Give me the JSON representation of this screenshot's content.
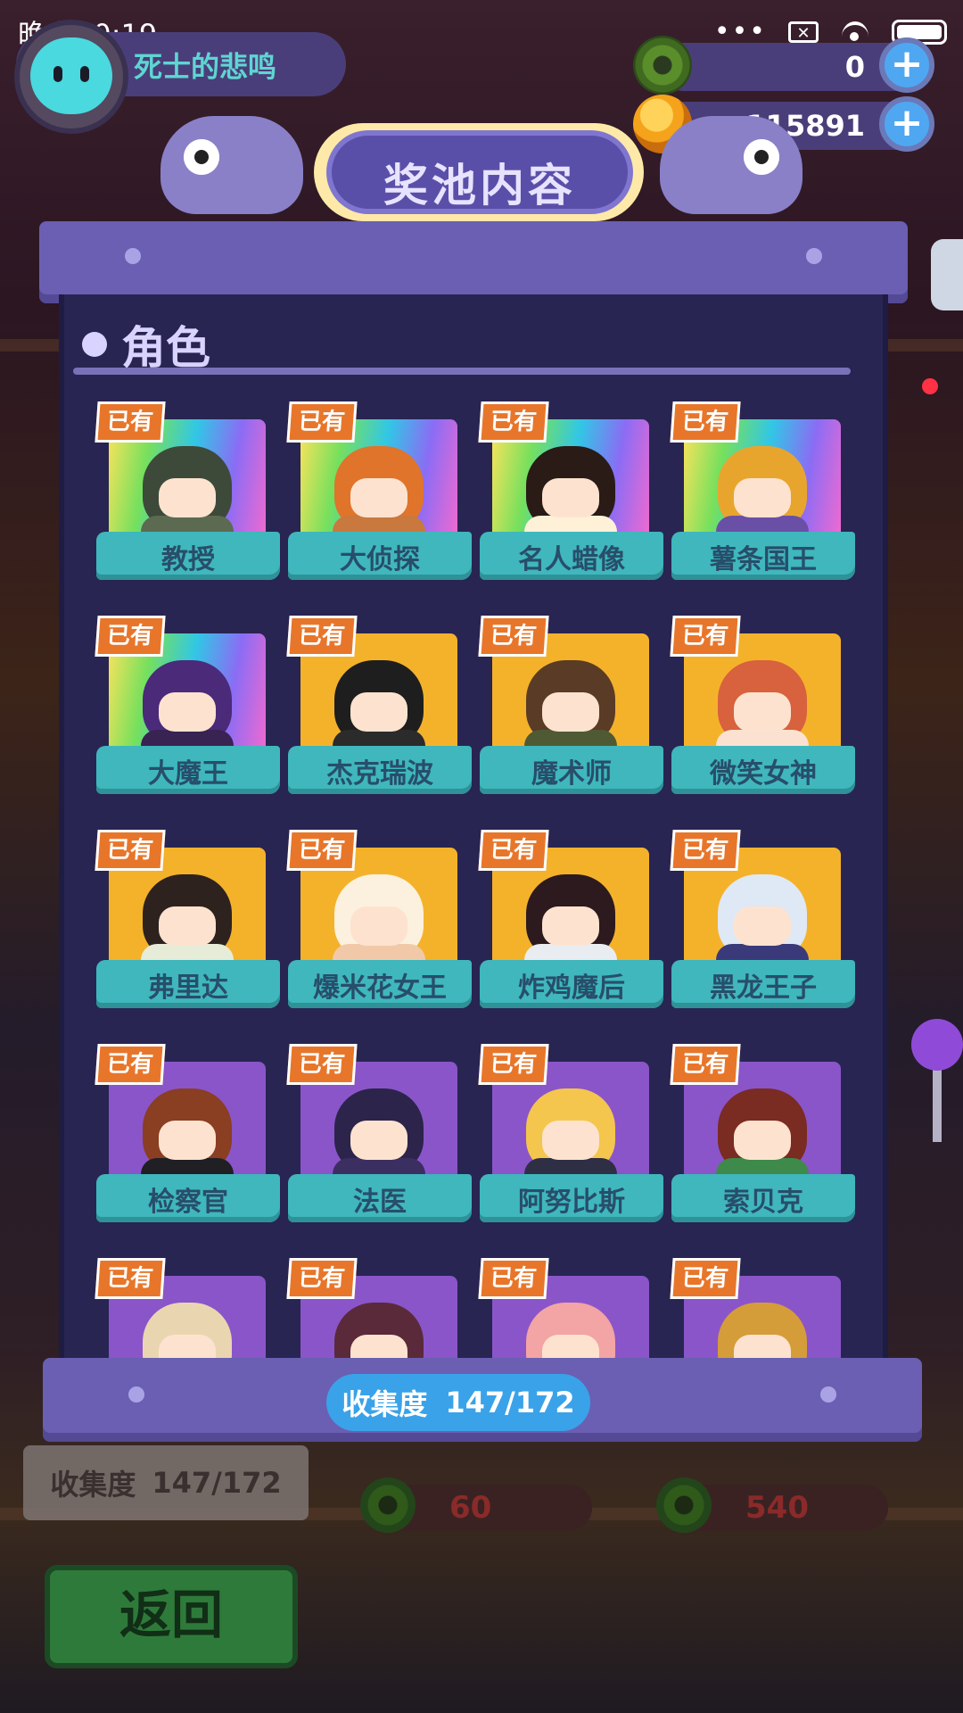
{
  "status_bar": {
    "time": "晚上10:19",
    "icons": [
      "more-dots-icon",
      "sim-x-icon",
      "wifi-icon",
      "battery-icon"
    ],
    "dots": "•••",
    "sim": "✕"
  },
  "player": {
    "name": "死士的悲鸣"
  },
  "currencies": {
    "donut": {
      "value": "0",
      "plus": "+"
    },
    "coin": {
      "value": "115891",
      "plus": "+"
    }
  },
  "title": "奖池内容",
  "section": {
    "label": "角色"
  },
  "owned_label": "已有",
  "characters": [
    {
      "name": "教授",
      "rarity": "rainbow",
      "hair": "#3d4a3a",
      "body": "#5c6a52"
    },
    {
      "name": "大侦探",
      "rarity": "rainbow",
      "hair": "#e0742a",
      "body": "#c9783e"
    },
    {
      "name": "名人蜡像",
      "rarity": "rainbow",
      "hair": "#2a1b17",
      "body": "#fff1d8"
    },
    {
      "name": "薯条国王",
      "rarity": "rainbow",
      "hair": "#e8a52e",
      "body": "#6a4fa6"
    },
    {
      "name": "大魔王",
      "rarity": "rainbow",
      "hair": "#4b2a7a",
      "body": "#382352"
    },
    {
      "name": "杰克瑞波",
      "rarity": "gold",
      "hair": "#1e1e1e",
      "body": "#2b2b2b"
    },
    {
      "name": "魔术师",
      "rarity": "gold",
      "hair": "#5a3b25",
      "body": "#4f5a34"
    },
    {
      "name": "微笑女神",
      "rarity": "gold",
      "hair": "#d8613e",
      "body": "#fbe2d0"
    },
    {
      "name": "弗里达",
      "rarity": "gold",
      "hair": "#2e221e",
      "body": "#e6ecd8"
    },
    {
      "name": "爆米花女王",
      "rarity": "gold",
      "hair": "#fbf1de",
      "body": "#f2c9a8"
    },
    {
      "name": "炸鸡魔后",
      "rarity": "gold",
      "hair": "#2c1a1e",
      "body": "#e9edf2"
    },
    {
      "name": "黑龙王子",
      "rarity": "gold",
      "hair": "#dfe8f5",
      "body": "#3a3a7a"
    },
    {
      "name": "检察官",
      "rarity": "purple",
      "hair": "#8a3e22",
      "body": "#1f1f24"
    },
    {
      "name": "法医",
      "rarity": "purple",
      "hair": "#2c244a",
      "body": "#3b2f62"
    },
    {
      "name": "阿努比斯",
      "rarity": "purple",
      "hair": "#f4c64d",
      "body": "#2e2f45"
    },
    {
      "name": "索贝克",
      "rarity": "purple",
      "hair": "#7a2b22",
      "body": "#3d8a4a"
    },
    {
      "name": "",
      "rarity": "purple",
      "hair": "#e9d6b0",
      "body": "#e9d6b0"
    },
    {
      "name": "",
      "rarity": "purple",
      "hair": "#5a2a3a",
      "body": "#5a2a3a"
    },
    {
      "name": "",
      "rarity": "purple",
      "hair": "#f3a4a4",
      "body": "#f3a4a4"
    },
    {
      "name": "",
      "rarity": "purple",
      "hair": "#d59c3a",
      "body": "#d59c3a"
    }
  ],
  "collection": {
    "label": "收集度",
    "value": "147/172"
  },
  "under": {
    "collection_label": "收集度",
    "collection_value": "147/172",
    "price_left": "60",
    "price_right": "540",
    "back": "返回"
  },
  "colors": {
    "accent": "#3fb7bd",
    "owned": "#e8762a",
    "panel": "#282552",
    "frame": "#6a5fb2"
  }
}
